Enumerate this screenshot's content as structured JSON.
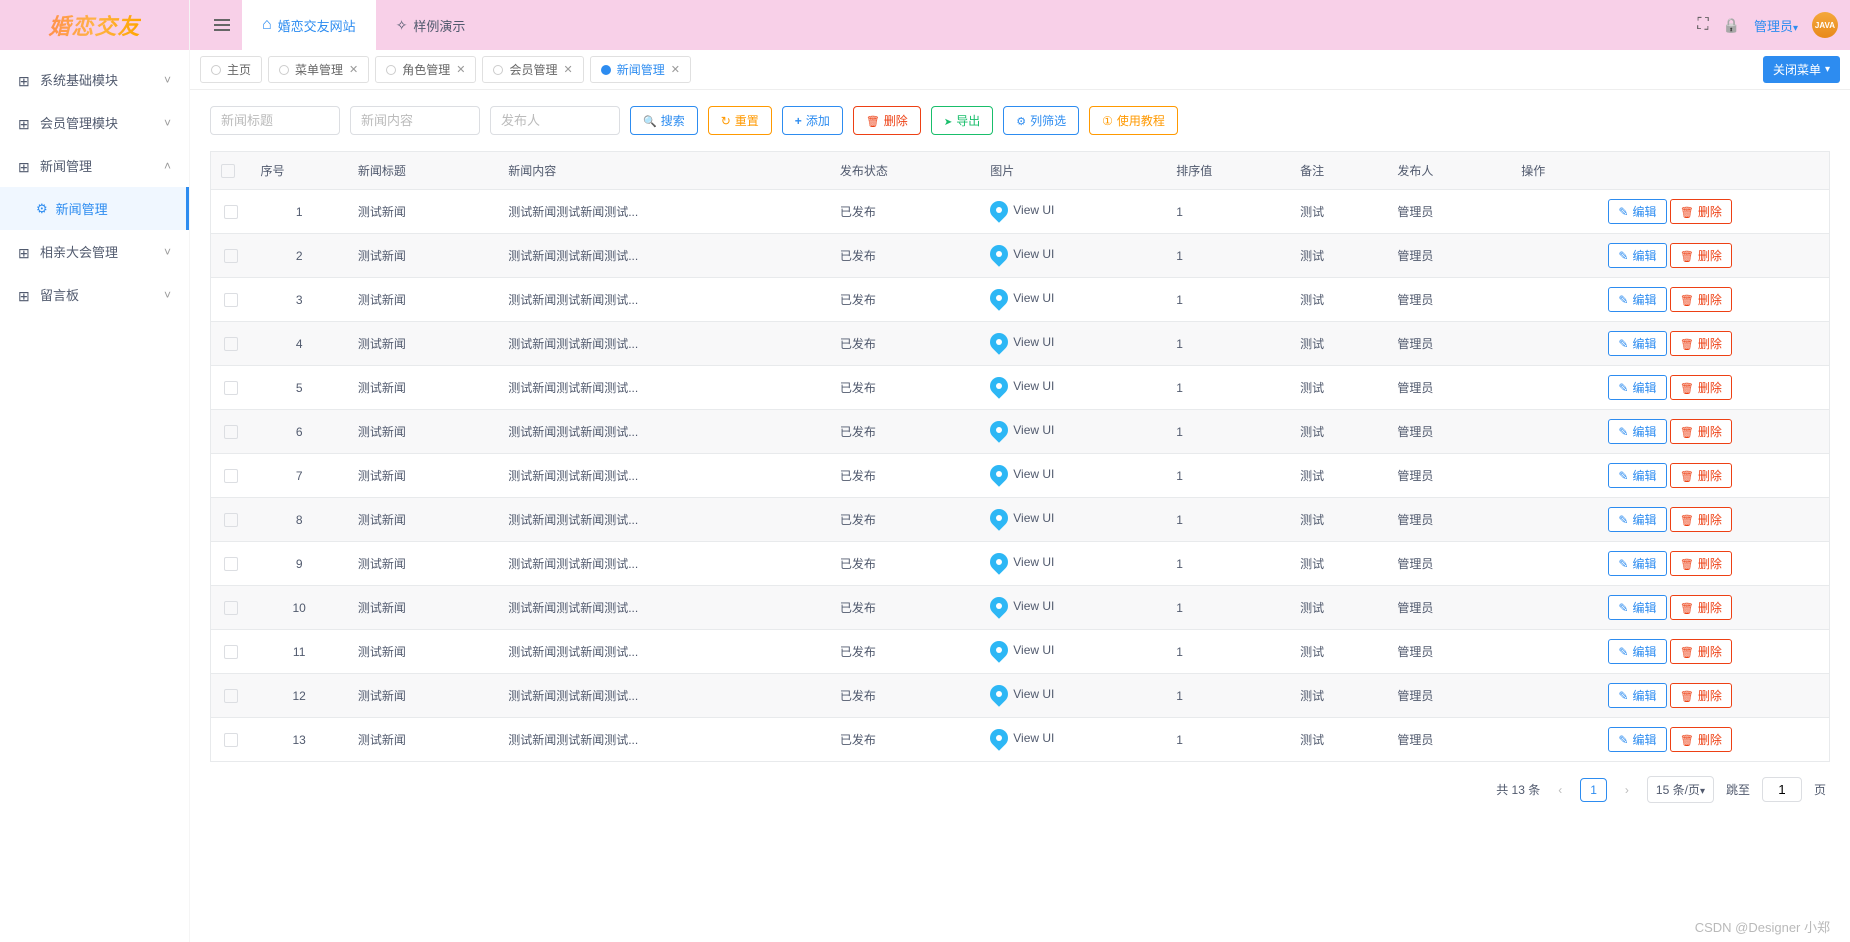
{
  "app": {
    "logo_text": "婚恋交友"
  },
  "top_tabs": [
    {
      "label": "婚恋交友网站",
      "active": true
    },
    {
      "label": "样例演示",
      "active": false
    }
  ],
  "user": {
    "name": "管理员",
    "avatar_text": "JAVA"
  },
  "sidebar": {
    "items": [
      {
        "label": "系统基础模块",
        "expanded": false
      },
      {
        "label": "会员管理模块",
        "expanded": false
      },
      {
        "label": "新闻管理",
        "expanded": true,
        "children": [
          {
            "label": "新闻管理",
            "active": true
          }
        ]
      },
      {
        "label": "相亲大会管理",
        "expanded": false
      },
      {
        "label": "留言板",
        "expanded": false
      }
    ]
  },
  "page_tabs": {
    "items": [
      {
        "label": "主页",
        "closable": false,
        "active": false
      },
      {
        "label": "菜单管理",
        "closable": true,
        "active": false
      },
      {
        "label": "角色管理",
        "closable": true,
        "active": false
      },
      {
        "label": "会员管理",
        "closable": true,
        "active": false
      },
      {
        "label": "新闻管理",
        "closable": true,
        "active": true
      }
    ],
    "close_menu_label": "关闭菜单"
  },
  "filters": {
    "title_placeholder": "新闻标题",
    "content_placeholder": "新闻内容",
    "publisher_placeholder": "发布人"
  },
  "toolbar": {
    "search": "搜索",
    "reset": "重置",
    "add": "添加",
    "delete": "删除",
    "export": "导出",
    "columns": "列筛选",
    "help": "使用教程"
  },
  "table": {
    "columns": {
      "seq": "序号",
      "title": "新闻标题",
      "content": "新闻内容",
      "status": "发布状态",
      "image": "图片",
      "sort": "排序值",
      "remark": "备注",
      "publisher": "发布人",
      "action": "操作"
    },
    "image_label": "View UI",
    "actions": {
      "edit": "编辑",
      "delete": "删除"
    },
    "rows": [
      {
        "seq": "1",
        "title": "测试新闻",
        "content": "测试新闻测试新闻测试...",
        "status": "已发布",
        "sort": "1",
        "remark": "测试",
        "publisher": "管理员"
      },
      {
        "seq": "2",
        "title": "测试新闻",
        "content": "测试新闻测试新闻测试...",
        "status": "已发布",
        "sort": "1",
        "remark": "测试",
        "publisher": "管理员"
      },
      {
        "seq": "3",
        "title": "测试新闻",
        "content": "测试新闻测试新闻测试...",
        "status": "已发布",
        "sort": "1",
        "remark": "测试",
        "publisher": "管理员"
      },
      {
        "seq": "4",
        "title": "测试新闻",
        "content": "测试新闻测试新闻测试...",
        "status": "已发布",
        "sort": "1",
        "remark": "测试",
        "publisher": "管理员"
      },
      {
        "seq": "5",
        "title": "测试新闻",
        "content": "测试新闻测试新闻测试...",
        "status": "已发布",
        "sort": "1",
        "remark": "测试",
        "publisher": "管理员"
      },
      {
        "seq": "6",
        "title": "测试新闻",
        "content": "测试新闻测试新闻测试...",
        "status": "已发布",
        "sort": "1",
        "remark": "测试",
        "publisher": "管理员"
      },
      {
        "seq": "7",
        "title": "测试新闻",
        "content": "测试新闻测试新闻测试...",
        "status": "已发布",
        "sort": "1",
        "remark": "测试",
        "publisher": "管理员"
      },
      {
        "seq": "8",
        "title": "测试新闻",
        "content": "测试新闻测试新闻测试...",
        "status": "已发布",
        "sort": "1",
        "remark": "测试",
        "publisher": "管理员"
      },
      {
        "seq": "9",
        "title": "测试新闻",
        "content": "测试新闻测试新闻测试...",
        "status": "已发布",
        "sort": "1",
        "remark": "测试",
        "publisher": "管理员"
      },
      {
        "seq": "10",
        "title": "测试新闻",
        "content": "测试新闻测试新闻测试...",
        "status": "已发布",
        "sort": "1",
        "remark": "测试",
        "publisher": "管理员"
      },
      {
        "seq": "11",
        "title": "测试新闻",
        "content": "测试新闻测试新闻测试...",
        "status": "已发布",
        "sort": "1",
        "remark": "测试",
        "publisher": "管理员"
      },
      {
        "seq": "12",
        "title": "测试新闻",
        "content": "测试新闻测试新闻测试...",
        "status": "已发布",
        "sort": "1",
        "remark": "测试",
        "publisher": "管理员"
      },
      {
        "seq": "13",
        "title": "测试新闻",
        "content": "测试新闻测试新闻测试...",
        "status": "已发布",
        "sort": "1",
        "remark": "测试",
        "publisher": "管理员"
      }
    ]
  },
  "pagination": {
    "total_label": "共 13 条",
    "current": "1",
    "size_label": "15 条/页",
    "jump_label": "跳至",
    "page_suffix": "页",
    "page_input": "1"
  },
  "watermark": "CSDN @Designer 小郑"
}
